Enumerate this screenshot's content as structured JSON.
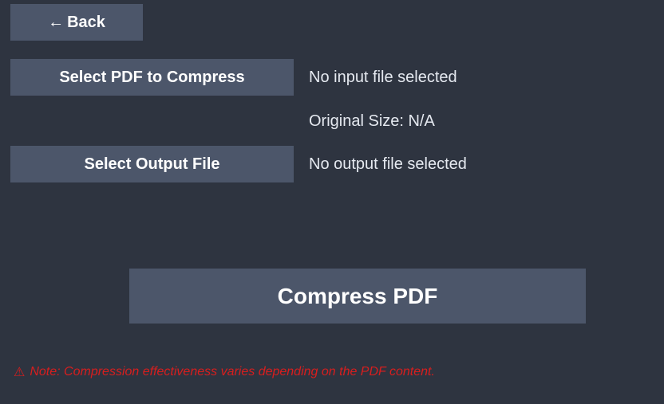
{
  "navigation": {
    "back_arrow": "←",
    "back_label": "Back"
  },
  "input": {
    "select_label": "Select PDF to Compress",
    "status": "No input file selected",
    "original_size": "Original Size: N/A"
  },
  "output": {
    "select_label": "Select Output File",
    "status": "No output file selected"
  },
  "actions": {
    "compress_label": "Compress PDF"
  },
  "note": {
    "icon": "warning-icon",
    "icon_glyph": "⚠",
    "text": "Note: Compression effectiveness varies depending on the PDF content."
  },
  "colors": {
    "background": "#2e3440",
    "button": "#4c566a",
    "text": "#e5e9f0",
    "warning": "#d81e1e"
  }
}
